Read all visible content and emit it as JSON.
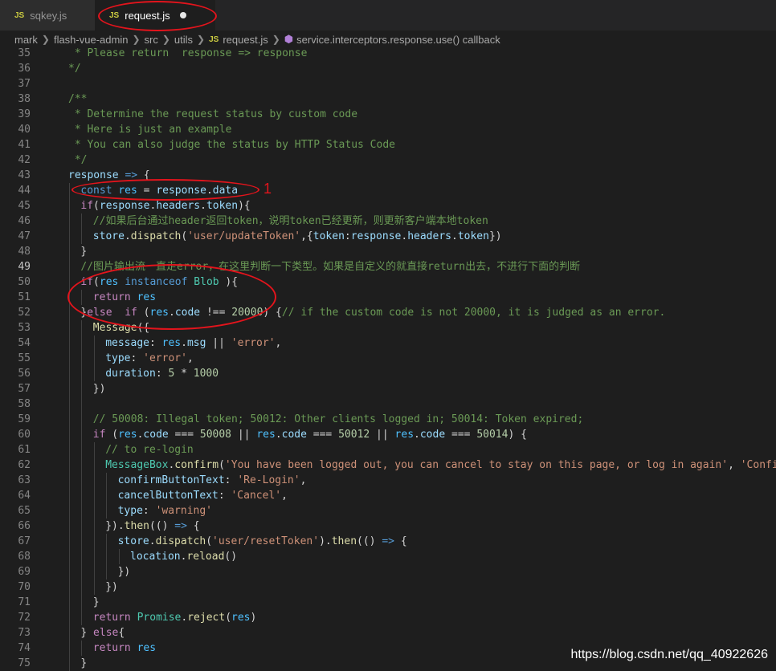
{
  "tabs": [
    {
      "icon": "JS",
      "label": "sqkey.js",
      "active": false
    },
    {
      "icon": "JS",
      "label": "request.js",
      "active": true,
      "dirty": true
    }
  ],
  "breadcrumb": {
    "items": [
      "mark",
      "flash-vue-admin",
      "src",
      "utils",
      "request.js",
      "service.interceptors.response.use() callback"
    ],
    "file_icon": "JS"
  },
  "editor": {
    "current_line": 49,
    "lines": [
      {
        "n": 35,
        "i": 0,
        "t": [
          [
            " * Please return  response => response",
            "cm"
          ]
        ]
      },
      {
        "n": 36,
        "i": 0,
        "t": [
          "*/",
          "cm"
        ]
      },
      {
        "n": 37,
        "i": 0,
        "t": []
      },
      {
        "n": 38,
        "i": 0,
        "t": [
          [
            "/**",
            "cm"
          ]
        ]
      },
      {
        "n": 39,
        "i": 0,
        "t": [
          [
            " * Determine the request status by custom code",
            "cm"
          ]
        ]
      },
      {
        "n": 40,
        "i": 0,
        "t": [
          [
            " * Here is just an example",
            "cm"
          ]
        ]
      },
      {
        "n": 41,
        "i": 0,
        "t": [
          [
            " * You can also judge the status by HTTP Status Code",
            "cm"
          ]
        ]
      },
      {
        "n": 42,
        "i": 0,
        "t": [
          [
            " */",
            "cm"
          ]
        ]
      },
      {
        "n": 43,
        "i": 0,
        "t": [
          [
            "response",
            "var"
          ],
          [
            " ",
            "p"
          ],
          [
            "=>",
            "kw"
          ],
          [
            " {",
            "p"
          ]
        ]
      },
      {
        "n": 44,
        "i": 1,
        "t": [
          [
            "const",
            "kw"
          ],
          [
            " ",
            "p"
          ],
          [
            "res",
            "const"
          ],
          [
            " = ",
            "p"
          ],
          [
            "response",
            "var"
          ],
          [
            ".",
            "p"
          ],
          [
            "data",
            "var"
          ]
        ]
      },
      {
        "n": 45,
        "i": 1,
        "t": [
          [
            "if",
            "ctl"
          ],
          [
            "(",
            "p"
          ],
          [
            "response",
            "var"
          ],
          [
            ".",
            "p"
          ],
          [
            "headers",
            "var"
          ],
          [
            ".",
            "p"
          ],
          [
            "token",
            "var"
          ],
          [
            "){",
            "p"
          ]
        ]
      },
      {
        "n": 46,
        "i": 2,
        "t": [
          [
            "//如果后台通过header返回token，说明token已经更新，则更新客户端本地token",
            "cm"
          ]
        ]
      },
      {
        "n": 47,
        "i": 2,
        "t": [
          [
            "store",
            "var"
          ],
          [
            ".",
            "p"
          ],
          [
            "dispatch",
            "fn"
          ],
          [
            "(",
            "p"
          ],
          [
            "'user/updateToken'",
            "str"
          ],
          [
            ",{",
            "p"
          ],
          [
            "token",
            "var"
          ],
          [
            ":",
            "p"
          ],
          [
            "response",
            "var"
          ],
          [
            ".",
            "p"
          ],
          [
            "headers",
            "var"
          ],
          [
            ".",
            "p"
          ],
          [
            "token",
            "var"
          ],
          [
            "})",
            "p"
          ]
        ]
      },
      {
        "n": 48,
        "i": 1,
        "t": [
          [
            "}",
            "p"
          ]
        ]
      },
      {
        "n": 49,
        "i": 1,
        "t": [
          [
            "//图片输出流一直走error，在这里判断一下类型。如果是自定义的就直接return出去，不进行下面的判断",
            "cm"
          ]
        ]
      },
      {
        "n": 50,
        "i": 1,
        "t": [
          [
            "if",
            "ctl"
          ],
          [
            "(",
            "p"
          ],
          [
            "res",
            "const"
          ],
          [
            " ",
            "p"
          ],
          [
            "instanceof",
            "kw"
          ],
          [
            " ",
            "p"
          ],
          [
            "Blob",
            "type"
          ],
          [
            " ){",
            "p"
          ]
        ]
      },
      {
        "n": 51,
        "i": 2,
        "t": [
          [
            "return",
            "ctl"
          ],
          [
            " ",
            "p"
          ],
          [
            "res",
            "const"
          ]
        ]
      },
      {
        "n": 52,
        "i": 1,
        "t": [
          [
            "}",
            "p"
          ],
          [
            "else",
            "ctl"
          ],
          [
            "  ",
            "p"
          ],
          [
            "if",
            "ctl"
          ],
          [
            " (",
            "p"
          ],
          [
            "res",
            "const"
          ],
          [
            ".",
            "p"
          ],
          [
            "code",
            "var"
          ],
          [
            " !== ",
            "p"
          ],
          [
            "20000",
            "num"
          ],
          [
            ") {",
            "p"
          ],
          [
            "// if the custom code is not 20000, it is judged as an error.",
            "cm"
          ]
        ]
      },
      {
        "n": 53,
        "i": 2,
        "t": [
          [
            "Message",
            "fn"
          ],
          [
            "({",
            "p"
          ]
        ]
      },
      {
        "n": 54,
        "i": 3,
        "t": [
          [
            "message",
            "var"
          ],
          [
            ": ",
            "p"
          ],
          [
            "res",
            "const"
          ],
          [
            ".",
            "p"
          ],
          [
            "msg",
            "var"
          ],
          [
            " || ",
            "p"
          ],
          [
            "'error'",
            "str"
          ],
          [
            ",",
            "p"
          ]
        ]
      },
      {
        "n": 55,
        "i": 3,
        "t": [
          [
            "type",
            "var"
          ],
          [
            ": ",
            "p"
          ],
          [
            "'error'",
            "str"
          ],
          [
            ",",
            "p"
          ]
        ]
      },
      {
        "n": 56,
        "i": 3,
        "t": [
          [
            "duration",
            "var"
          ],
          [
            ": ",
            "p"
          ],
          [
            "5",
            "num"
          ],
          [
            " * ",
            "p"
          ],
          [
            "1000",
            "num"
          ]
        ]
      },
      {
        "n": 57,
        "i": 2,
        "t": [
          [
            "})",
            "p"
          ]
        ]
      },
      {
        "n": 58,
        "i": 2,
        "t": []
      },
      {
        "n": 59,
        "i": 2,
        "t": [
          [
            "// 50008: Illegal token; 50012: Other clients logged in; 50014: Token expired;",
            "cm"
          ]
        ]
      },
      {
        "n": 60,
        "i": 2,
        "t": [
          [
            "if",
            "ctl"
          ],
          [
            " (",
            "p"
          ],
          [
            "res",
            "const"
          ],
          [
            ".",
            "p"
          ],
          [
            "code",
            "var"
          ],
          [
            " === ",
            "p"
          ],
          [
            "50008",
            "num"
          ],
          [
            " || ",
            "p"
          ],
          [
            "res",
            "const"
          ],
          [
            ".",
            "p"
          ],
          [
            "code",
            "var"
          ],
          [
            " === ",
            "p"
          ],
          [
            "50012",
            "num"
          ],
          [
            " || ",
            "p"
          ],
          [
            "res",
            "const"
          ],
          [
            ".",
            "p"
          ],
          [
            "code",
            "var"
          ],
          [
            " === ",
            "p"
          ],
          [
            "50014",
            "num"
          ],
          [
            ") {",
            "p"
          ]
        ]
      },
      {
        "n": 61,
        "i": 3,
        "t": [
          [
            "// to re-login",
            "cm"
          ]
        ]
      },
      {
        "n": 62,
        "i": 3,
        "t": [
          [
            "MessageBox",
            "type"
          ],
          [
            ".",
            "p"
          ],
          [
            "confirm",
            "fn"
          ],
          [
            "(",
            "p"
          ],
          [
            "'You have been logged out, you can cancel to stay on this page, or log in again'",
            "str"
          ],
          [
            ", ",
            "p"
          ],
          [
            "'Confir",
            "str"
          ]
        ]
      },
      {
        "n": 63,
        "i": 4,
        "t": [
          [
            "confirmButtonText",
            "var"
          ],
          [
            ": ",
            "p"
          ],
          [
            "'Re-Login'",
            "str"
          ],
          [
            ",",
            "p"
          ]
        ]
      },
      {
        "n": 64,
        "i": 4,
        "t": [
          [
            "cancelButtonText",
            "var"
          ],
          [
            ": ",
            "p"
          ],
          [
            "'Cancel'",
            "str"
          ],
          [
            ",",
            "p"
          ]
        ]
      },
      {
        "n": 65,
        "i": 4,
        "t": [
          [
            "type",
            "var"
          ],
          [
            ": ",
            "p"
          ],
          [
            "'warning'",
            "str"
          ]
        ]
      },
      {
        "n": 66,
        "i": 3,
        "t": [
          [
            "}).",
            "p"
          ],
          [
            "then",
            "fn"
          ],
          [
            "(() ",
            "p"
          ],
          [
            "=>",
            "kw"
          ],
          [
            " {",
            "p"
          ]
        ]
      },
      {
        "n": 67,
        "i": 4,
        "t": [
          [
            "store",
            "var"
          ],
          [
            ".",
            "p"
          ],
          [
            "dispatch",
            "fn"
          ],
          [
            "(",
            "p"
          ],
          [
            "'user/resetToken'",
            "str"
          ],
          [
            ").",
            "p"
          ],
          [
            "then",
            "fn"
          ],
          [
            "(() ",
            "p"
          ],
          [
            "=>",
            "kw"
          ],
          [
            " {",
            "p"
          ]
        ]
      },
      {
        "n": 68,
        "i": 5,
        "t": [
          [
            "location",
            "var"
          ],
          [
            ".",
            "p"
          ],
          [
            "reload",
            "fn"
          ],
          [
            "()",
            "p"
          ]
        ]
      },
      {
        "n": 69,
        "i": 4,
        "t": [
          [
            "})",
            "p"
          ]
        ]
      },
      {
        "n": 70,
        "i": 3,
        "t": [
          [
            "})",
            "p"
          ]
        ]
      },
      {
        "n": 71,
        "i": 2,
        "t": [
          [
            "}",
            "p"
          ]
        ]
      },
      {
        "n": 72,
        "i": 2,
        "t": [
          [
            "return",
            "ctl"
          ],
          [
            " ",
            "p"
          ],
          [
            "Promise",
            "type"
          ],
          [
            ".",
            "p"
          ],
          [
            "reject",
            "fn"
          ],
          [
            "(",
            "p"
          ],
          [
            "res",
            "const"
          ],
          [
            ")",
            "p"
          ]
        ]
      },
      {
        "n": 73,
        "i": 1,
        "t": [
          [
            "} ",
            "p"
          ],
          [
            "else",
            "ctl"
          ],
          [
            "{",
            "p"
          ]
        ]
      },
      {
        "n": 74,
        "i": 2,
        "t": [
          [
            "return",
            "ctl"
          ],
          [
            " ",
            "p"
          ],
          [
            "res",
            "const"
          ]
        ]
      },
      {
        "n": 75,
        "i": 1,
        "t": [
          [
            "}",
            "p"
          ]
        ]
      }
    ]
  },
  "annotations": {
    "label_1": "1"
  },
  "watermark": "https://blog.csdn.net/qq_40922626",
  "colors": {
    "kw": "#569cd6",
    "ctl": "#c586c0",
    "var": "#9cdcfe",
    "const": "#4fc1ff",
    "str": "#ce9178",
    "num": "#b5cea8",
    "cm": "#6a9955",
    "fn": "#dcdcaa",
    "type": "#4ec9b0",
    "p": "#d4d4d4",
    "annotation": "#e3141c"
  }
}
